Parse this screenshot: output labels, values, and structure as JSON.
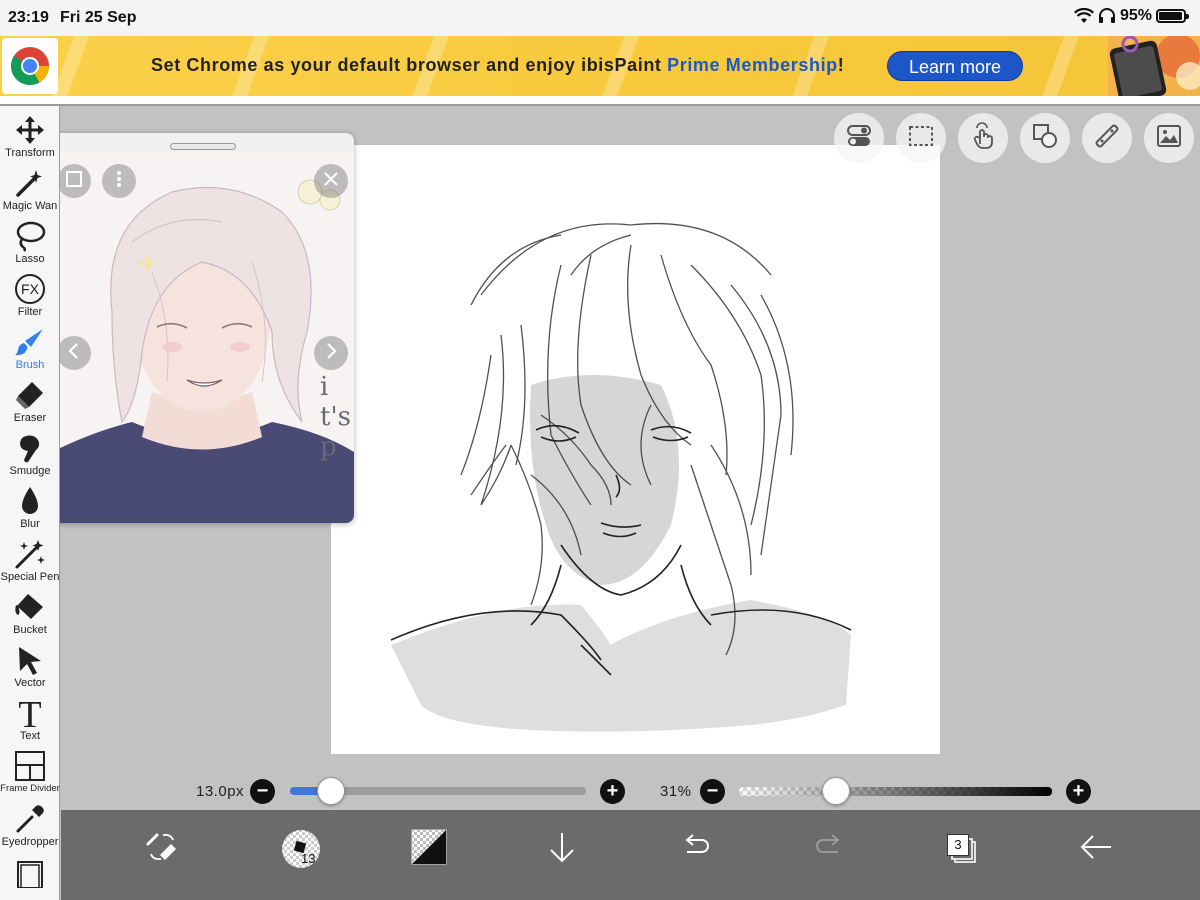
{
  "status_bar": {
    "time": "23:19",
    "date": "Fri 25 Sep",
    "battery": "95%",
    "battery_level": 0.95
  },
  "ad": {
    "text_prefix": "Set Chrome as your default browser and enjoy ibisPaint ",
    "text_highlight": "Prime Membership",
    "text_suffix": "!",
    "cta_label": "Learn more"
  },
  "tools": [
    {
      "id": "transform",
      "label": "Transform",
      "icon": "move-arrows-icon",
      "active": false
    },
    {
      "id": "magic-wand",
      "label": "Magic Wan",
      "icon": "magic-wand-icon",
      "active": false
    },
    {
      "id": "lasso",
      "label": "Lasso",
      "icon": "lasso-icon",
      "active": false
    },
    {
      "id": "filter",
      "label": "Filter",
      "icon": "fx-icon",
      "active": false
    },
    {
      "id": "brush",
      "label": "Brush",
      "icon": "brush-icon",
      "active": true
    },
    {
      "id": "eraser",
      "label": "Eraser",
      "icon": "eraser-icon",
      "active": false
    },
    {
      "id": "smudge",
      "label": "Smudge",
      "icon": "smudge-finger-icon",
      "active": false
    },
    {
      "id": "blur",
      "label": "Blur",
      "icon": "droplet-icon",
      "active": false
    },
    {
      "id": "special-pen",
      "label": "Special Pen",
      "icon": "sparkle-pen-icon",
      "active": false
    },
    {
      "id": "bucket",
      "label": "Bucket",
      "icon": "paint-bucket-icon",
      "active": false
    },
    {
      "id": "vector",
      "label": "Vector",
      "icon": "cursor-arrow-icon",
      "active": false
    },
    {
      "id": "text",
      "label": "Text",
      "icon": "text-t-icon",
      "active": false
    },
    {
      "id": "frame-divider",
      "label": "Frame Divider",
      "icon": "frame-divider-icon",
      "active": false
    },
    {
      "id": "eyedropper",
      "label": "Eyedropper",
      "icon": "eyedropper-icon",
      "active": false
    }
  ],
  "top_buttons": [
    "toggle-icon",
    "selection-icon",
    "touch-icon",
    "shapes-icon",
    "ruler-icon",
    "image-icon"
  ],
  "reference": {
    "text_fragment": "it's p"
  },
  "brush_slider": {
    "value_label": "13.0px",
    "fraction": 0.14
  },
  "opacity_slider": {
    "value_label": "31%",
    "fraction": 0.31
  },
  "bottom": {
    "brush_size": "13",
    "layer_count": "3"
  },
  "colors": {
    "accent": "#2f80ed",
    "ad_cta": "#1d56c7",
    "ad_background": "#f7c93a",
    "toolbar_bottom": "#6b6b6b"
  }
}
